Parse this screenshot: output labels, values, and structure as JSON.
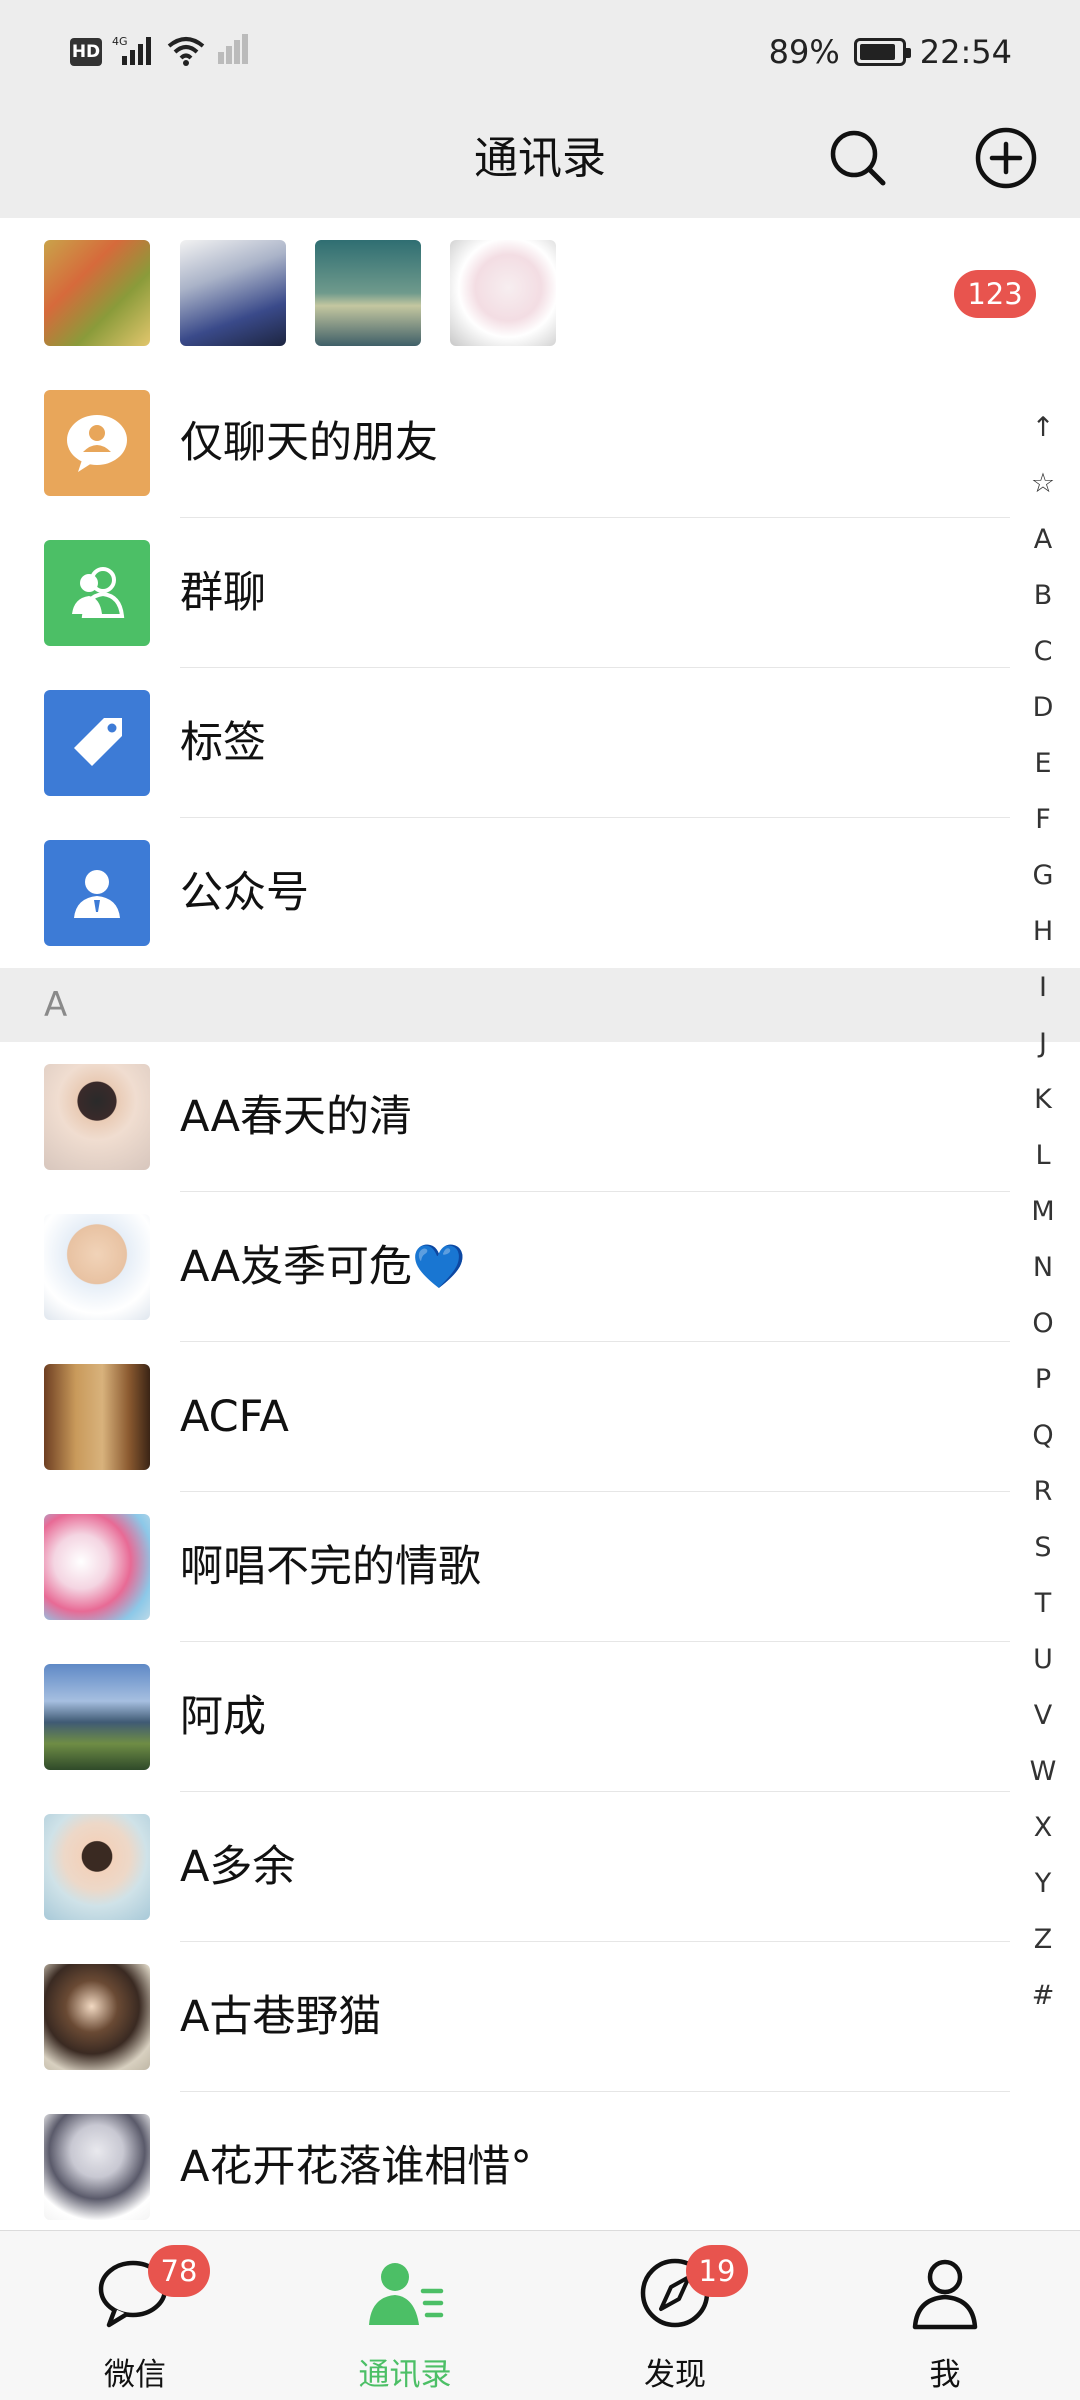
{
  "status_bar": {
    "left_text": "HD",
    "network": "4G",
    "battery_percent": "89%",
    "battery_level": 0.89,
    "time": "22:54"
  },
  "header": {
    "title": "通讯录",
    "search_icon": "search-icon",
    "add_icon": "plus-circle-icon"
  },
  "recent": {
    "count_badge": "123"
  },
  "features": [
    {
      "label": "仅聊天的朋友",
      "icon": "chat-person-icon",
      "color": "#e8a65a"
    },
    {
      "label": "群聊",
      "icon": "group-icon",
      "color": "#4cbf66"
    },
    {
      "label": "标签",
      "icon": "tag-icon",
      "color": "#3d7bd6"
    },
    {
      "label": "公众号",
      "icon": "official-account-icon",
      "color": "#3d7bd6"
    }
  ],
  "section": {
    "letter": "A"
  },
  "contacts": [
    {
      "name": "AA春天的清"
    },
    {
      "name": "AA岌季可危💙"
    },
    {
      "name": "ACFA"
    },
    {
      "name": "啊唱不完的情歌"
    },
    {
      "name": "阿成"
    },
    {
      "name": "A多余"
    },
    {
      "name": "A古巷野猫"
    },
    {
      "name": "A花开花落谁相惜°"
    }
  ],
  "index": [
    "↑",
    "☆",
    "A",
    "B",
    "C",
    "D",
    "E",
    "F",
    "G",
    "H",
    "I",
    "J",
    "K",
    "L",
    "M",
    "N",
    "O",
    "P",
    "Q",
    "R",
    "S",
    "T",
    "U",
    "V",
    "W",
    "X",
    "Y",
    "Z",
    "#"
  ],
  "bottom_nav": {
    "tabs": [
      {
        "label": "微信",
        "icon": "chat-bubble-icon",
        "badge": "78"
      },
      {
        "label": "通讯录",
        "icon": "contacts-icon",
        "active": true
      },
      {
        "label": "发现",
        "icon": "compass-icon",
        "badge": "19"
      },
      {
        "label": "我",
        "icon": "person-icon"
      }
    ]
  },
  "colors": {
    "accent": "#4cbf66",
    "badge": "#e8544e",
    "header_bg": "#ededed"
  }
}
